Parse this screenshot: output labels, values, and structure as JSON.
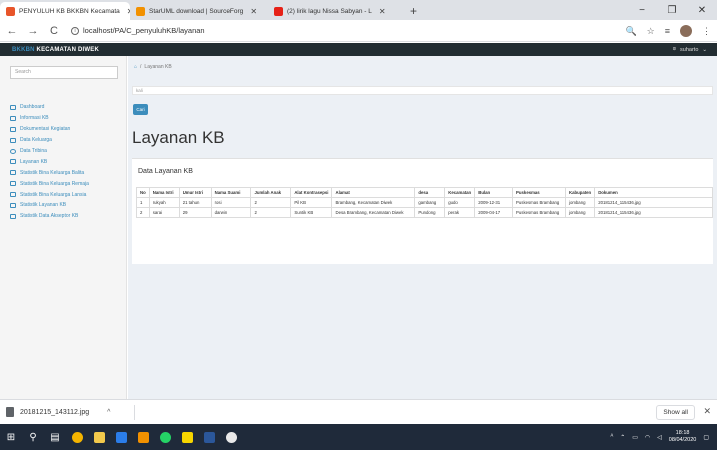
{
  "browser": {
    "tabs": [
      {
        "title": "PENYULUH KB BKKBN Kecamata",
        "close": "✕",
        "active": true,
        "color": "#e8552a"
      },
      {
        "title": "StarUML download | SourceForg",
        "close": "✕",
        "active": false,
        "color": "#f29100"
      },
      {
        "title": "(2) lirik lagu Nissa Sabyan - L",
        "close": "✕",
        "active": false,
        "color": "#e62117"
      }
    ],
    "new_tab": "+",
    "window_controls": {
      "minimize": "−",
      "maximize": "❐",
      "close": "✕"
    },
    "url": "localhost/PA/C_penyuluhKB/layanan",
    "nav": {
      "back": "←",
      "forward": "→",
      "reload": "C"
    },
    "addr_icons": {
      "zoom": "🔍",
      "star": "☆",
      "menu": "⋮"
    }
  },
  "app": {
    "brand_prefix": "BKKBN",
    "brand_rest": " KECAMATAN DIWEK",
    "user_name": "suharto",
    "user_caret": "⌄"
  },
  "sidebar": {
    "search_placeholder": "Search",
    "items": [
      {
        "label": "Dashboard"
      },
      {
        "label": "Informasi KB"
      },
      {
        "label": "Dokumentasi Kegiatan"
      },
      {
        "label": "Data Keluarga"
      },
      {
        "label": "Data Tribina"
      },
      {
        "label": "Layanan KB"
      },
      {
        "label": "Statistik Bina Keluarga Balita"
      },
      {
        "label": "Statistik Bina Keluarga Remaja"
      },
      {
        "label": "Statistik Bina Keluarga Lansia"
      },
      {
        "label": "Statistik Layanan KB"
      },
      {
        "label": "Statistik Data Akseptor KB"
      }
    ]
  },
  "main": {
    "breadcrumb": "Layanan KB",
    "search_value": "kali",
    "search_button": "Cari",
    "page_title": "Layanan KB",
    "box_title": "Data Layanan KB",
    "table": {
      "headers": [
        "No",
        "Nama Istri",
        "Umur Istri",
        "Nama Suami",
        "Jumlah Anak",
        "Alat Kontrasepsi",
        "Alamat",
        "desa",
        "Kecamatan",
        "Bulan",
        "Puskesmas",
        "Kabupaten",
        "Dokumen"
      ],
      "rows": [
        [
          "1",
          "rukyah",
          "21 tahun",
          "rosi",
          "2",
          "Pil KB",
          "Brambang, Kecamatan Diwek",
          "gambang",
          "gudo",
          "2009-12-31",
          "Puskesmas Brambang",
          "jombang",
          "20181214_115436.jpg"
        ],
        [
          "2",
          "sarai",
          "29",
          "darwin",
          "2",
          "Suntik KB",
          "Desa Brambang, Kecamatan Diwek",
          "Pundong",
          "perak",
          "2009-04-17",
          "Puskesmas Brambang",
          "jombang",
          "20181214_115436.jpg"
        ]
      ]
    }
  },
  "downloads": {
    "file": "20181215_143112.jpg",
    "chevron": "^",
    "show_all": "Show all",
    "close": "✕"
  },
  "taskbar": {
    "time": "18:18",
    "date": "08/04/2020",
    "tray_text": "ᴬ"
  }
}
